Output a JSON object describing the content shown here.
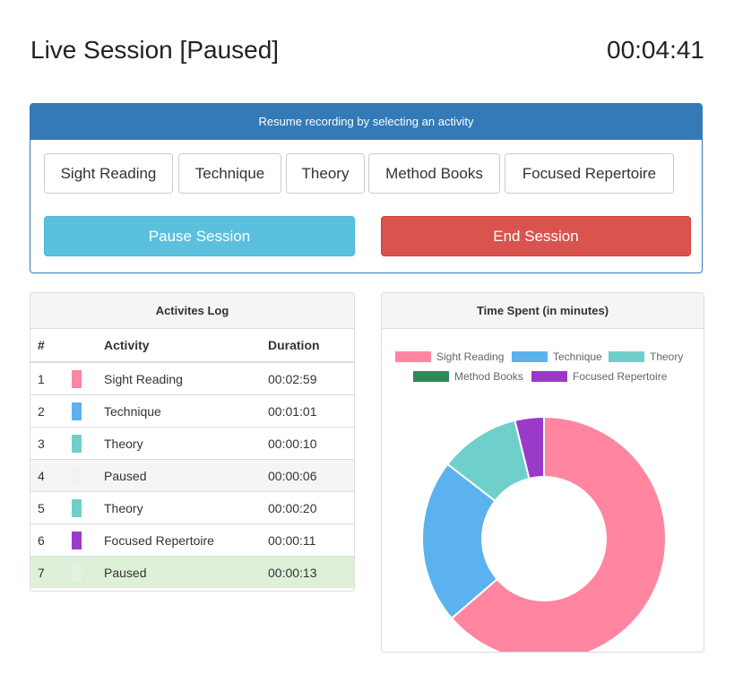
{
  "header": {
    "title": "Live Session [Paused]",
    "timer": "00:04:41"
  },
  "resume": {
    "heading": "Resume recording by selecting an activity",
    "activities": [
      "Sight Reading",
      "Technique",
      "Theory",
      "Method Books",
      "Focused Repertoire"
    ],
    "pause_label": "Pause Session",
    "end_label": "End Session"
  },
  "log": {
    "title": "Activites Log",
    "columns": [
      "#",
      "Activity",
      "Duration"
    ],
    "rows": [
      {
        "num": "1",
        "activity": "Sight Reading",
        "duration": "00:02:59",
        "color": "#ff85a0"
      },
      {
        "num": "2",
        "activity": "Technique",
        "duration": "00:01:01",
        "color": "#5bb2ee"
      },
      {
        "num": "3",
        "activity": "Theory",
        "duration": "00:00:10",
        "color": "#6fcfca"
      },
      {
        "num": "4",
        "activity": "Paused",
        "duration": "00:00:06",
        "color": "#f3f3f3"
      },
      {
        "num": "5",
        "activity": "Theory",
        "duration": "00:00:20",
        "color": "#6fcfca"
      },
      {
        "num": "6",
        "activity": "Focused Repertoire",
        "duration": "00:00:11",
        "color": "#9b3ac9"
      },
      {
        "num": "7",
        "activity": "Paused",
        "duration": "00:00:13",
        "color": "#e8f0e4"
      }
    ]
  },
  "chart": {
    "title": "Time Spent (in minutes)"
  },
  "chart_data": {
    "type": "pie",
    "donut": true,
    "categories": [
      "Sight Reading",
      "Technique",
      "Theory",
      "Method Books",
      "Focused Repertoire"
    ],
    "values": [
      2.98,
      1.02,
      0.5,
      0,
      0.18
    ],
    "colors": [
      "#ff85a0",
      "#5bb2ee",
      "#6fcfca",
      "#2e8b57",
      "#9b3ac9"
    ],
    "legend_position": "top"
  }
}
